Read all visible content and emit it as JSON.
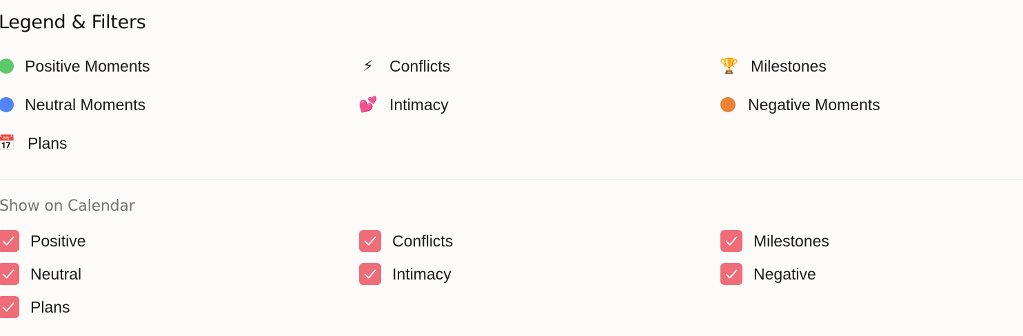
{
  "legend": {
    "title": "Legend & Filters",
    "items": [
      {
        "label": "Positive Moments",
        "color": "#5cc96b",
        "kind": "dot"
      },
      {
        "label": "Conflicts",
        "icon": "lightning-icon",
        "glyph": "⚡",
        "kind": "emoji"
      },
      {
        "label": "Milestones",
        "icon": "trophy-icon",
        "glyph": "🏆",
        "kind": "emoji"
      },
      {
        "label": "Neutral Moments",
        "color": "#4f86f2",
        "kind": "dot"
      },
      {
        "label": "Intimacy",
        "icon": "two-hearts-icon",
        "glyph": "💕",
        "kind": "emoji"
      },
      {
        "label": "Negative Moments",
        "color": "#ea8338",
        "kind": "dot"
      },
      {
        "label": "Plans",
        "icon": "calendar-icon",
        "glyph": "📅",
        "kind": "emoji"
      }
    ]
  },
  "filters": {
    "title": "Show on Calendar",
    "checkbox_color": "#ee6d78",
    "items": [
      {
        "label": "Positive",
        "checked": true
      },
      {
        "label": "Conflicts",
        "checked": true
      },
      {
        "label": "Milestones",
        "checked": true
      },
      {
        "label": "Neutral",
        "checked": true
      },
      {
        "label": "Intimacy",
        "checked": true
      },
      {
        "label": "Negative",
        "checked": true
      },
      {
        "label": "Plans",
        "checked": true
      }
    ]
  }
}
